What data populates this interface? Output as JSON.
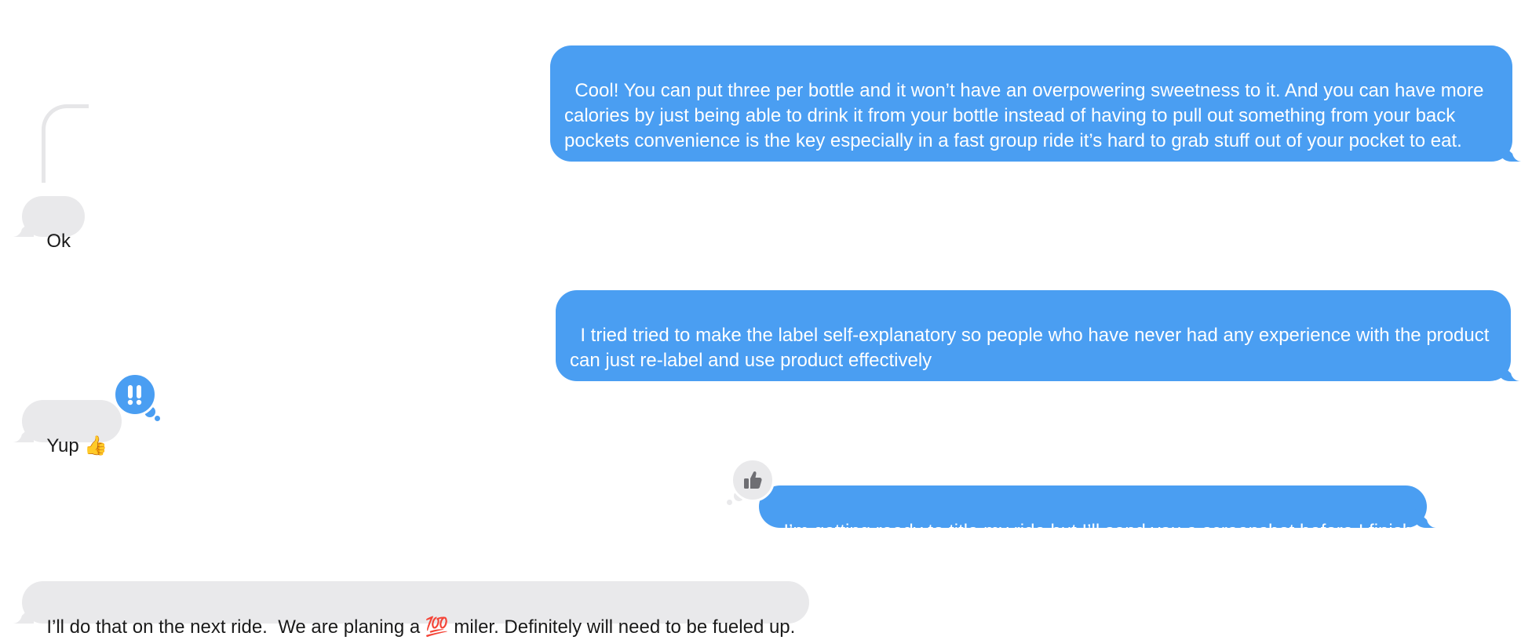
{
  "colors": {
    "outgoing_bubble": "#4a9ef2",
    "incoming_bubble": "#e9e9eb",
    "outgoing_text": "#ffffff",
    "incoming_text": "#1a1a1a",
    "background": "#ffffff"
  },
  "messages": [
    {
      "direction": "outgoing",
      "text": "Cool! You can put three per bottle and it won’t have an overpowering sweetness to it. And you can have more calories by just being able to drink it from your bottle instead of having to pull out something from your back pockets convenience is the key especially in a fast group ride it’s hard to grab stuff out of your pocket to eat."
    },
    {
      "direction": "incoming",
      "text": "Ok",
      "is_reply_thread": true
    },
    {
      "direction": "outgoing",
      "text": "I tried tried to make the label self-explanatory so people who have never had any experience with the product can just re-label and use product effectively"
    },
    {
      "direction": "incoming",
      "text": "Yup 👍",
      "tapback": "exclamation-icon"
    },
    {
      "direction": "outgoing",
      "text": "I’m getting ready to title my ride but I’ll send you a screenshot before I finish",
      "tapback": "thumbs-up-icon"
    },
    {
      "direction": "incoming",
      "text": "I’ll do that on the next ride.  We are planing a 💯 miler. Definitely will need to be fueled up."
    }
  ]
}
